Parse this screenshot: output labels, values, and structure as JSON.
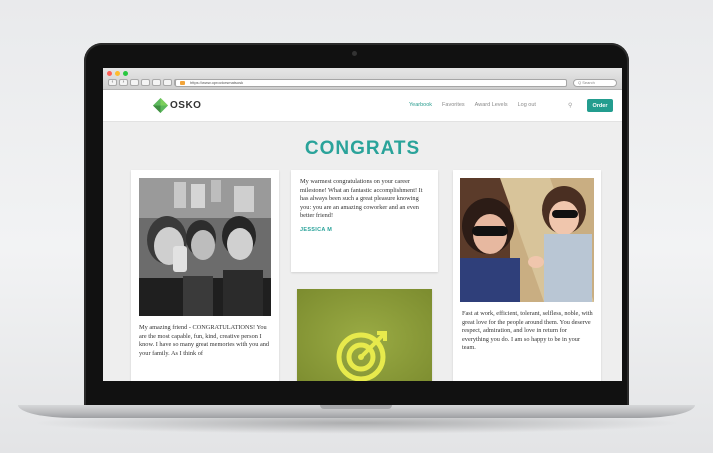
{
  "browser": {
    "url": "https://www.oproctorsmatsosk",
    "search_placeholder": "Q Search"
  },
  "site": {
    "logo_text": "OSKO",
    "nav": {
      "items": [
        "Yearbook",
        "Favorites",
        "Award Levels",
        "Log out"
      ],
      "active_index": 0
    },
    "order_button": "Order",
    "search_icon": "search-icon"
  },
  "page": {
    "headline": "CONGRATS"
  },
  "cards": {
    "left": {
      "message": "My amazing friend - CONGRATULATIONS! You are the most capable, fun, kind, creative person I know. I have so many great memories with you and your family. As I think of"
    },
    "middle": {
      "message": "My warmest congratulations on your career milestone! What an fantastic accomplishment! It has always been such a great pleasure knowing you: you are an amazing coworker and an even better friend!",
      "author": "JESSICA M"
    },
    "right": {
      "message": "Fast at work, efficient, tolerant, selfless, noble, with great love for the people around them. You deserve respect, admiration, and love in return for everything you do. I am so happy to be in your team."
    }
  },
  "colors": {
    "accent": "#2aa39a",
    "order_button": "#239d8f",
    "logo_green": "#5cb85c",
    "target_green": "#8fa03a"
  }
}
